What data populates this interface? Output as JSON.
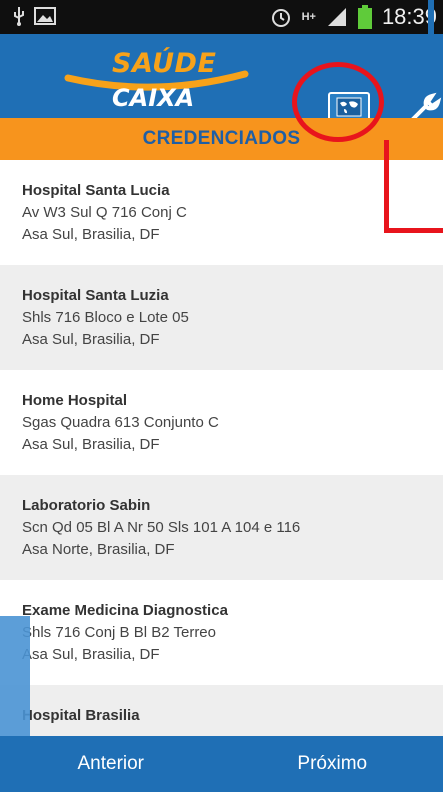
{
  "status_bar": {
    "time": "18:39",
    "icons": [
      "usb-icon",
      "image-icon",
      "alarm-icon",
      "hplus-icon",
      "signal-icon",
      "battery-icon"
    ],
    "network": "H+"
  },
  "header": {
    "logo_top": "SAÚDE",
    "logo_bottom": "CAIXA",
    "map_icon": "map-icon",
    "settings_icon": "wrench-icon"
  },
  "title": "CREDENCIADOS",
  "items": [
    {
      "name": "Hospital Santa Lucia",
      "line1": "Av W3 Sul Q 716 Conj C",
      "line2": "Asa Sul, Brasilia, DF"
    },
    {
      "name": "Hospital Santa Luzia",
      "line1": "Shls 716 Bloco e Lote 05",
      "line2": "Asa Sul, Brasilia, DF"
    },
    {
      "name": "Home Hospital",
      "line1": "Sgas Quadra 613 Conjunto C",
      "line2": "Asa Sul, Brasilia, DF"
    },
    {
      "name": "Laboratorio Sabin",
      "line1": "Scn Qd 05 Bl A Nr 50 Sls 101 A 104 e 116",
      "line2": "Asa Norte, Brasilia, DF"
    },
    {
      "name": "Exame Medicina Diagnostica",
      "line1": "Shls 716 Conj B Bl B2 Terreo",
      "line2": "Asa Sul, Brasilia, DF"
    },
    {
      "name": "Hospital Brasilia",
      "line1": "",
      "line2": ""
    }
  ],
  "nav": {
    "previous": "Anterior",
    "next": "Próximo"
  },
  "colors": {
    "header_blue": "#1f6fb5",
    "title_orange": "#f7941d",
    "annotation_red": "#e8141c"
  }
}
